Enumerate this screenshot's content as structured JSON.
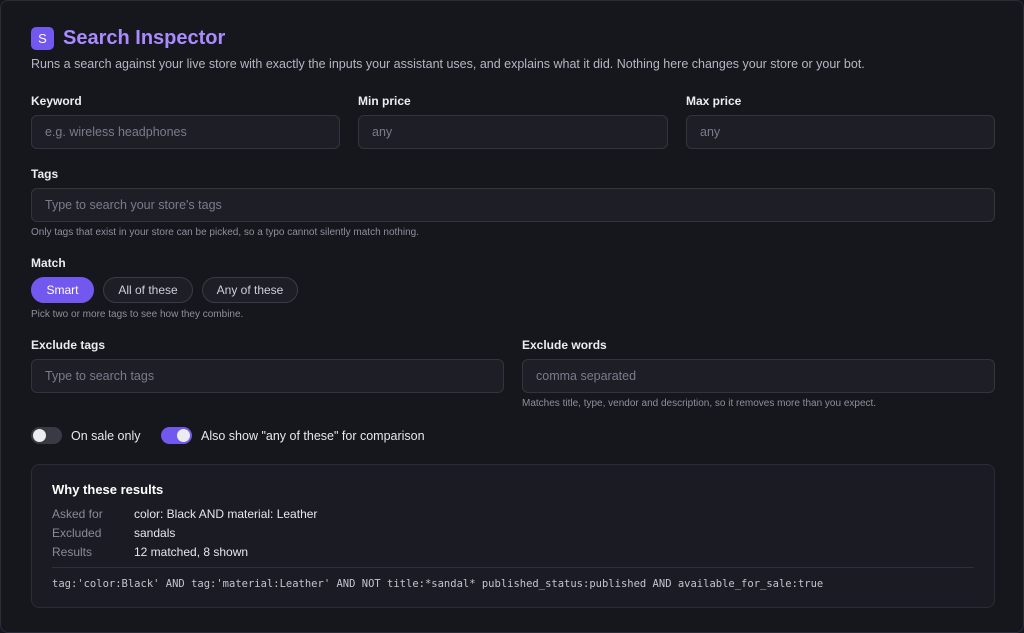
{
  "header": {
    "logo_letter": "S",
    "title": "Search Inspector",
    "subtitle": "Runs a search against your live store with exactly the inputs your assistant uses, and explains what it did. Nothing here changes your store or your bot."
  },
  "keyword": {
    "label": "Keyword",
    "placeholder": "e.g. wireless headphones",
    "value": ""
  },
  "min_price": {
    "label": "Min price",
    "placeholder": "any",
    "value": ""
  },
  "max_price": {
    "label": "Max price",
    "placeholder": "any",
    "value": ""
  },
  "tags": {
    "label": "Tags",
    "placeholder": "Type to search your store's tags",
    "help": "Only tags that exist in your store can be picked, so a typo cannot silently match nothing."
  },
  "match": {
    "label": "Match",
    "options": [
      "Smart",
      "All of these",
      "Any of these"
    ],
    "selected": "Smart",
    "help": "Pick two or more tags to see how they combine."
  },
  "exclude_tags": {
    "label": "Exclude tags",
    "placeholder": "Type to search tags"
  },
  "exclude_words": {
    "label": "Exclude words",
    "placeholder": "comma separated",
    "help": "Matches title, type, vendor and description, so it removes more than you expect."
  },
  "toggles": {
    "on_sale": {
      "label": "On sale only",
      "checked": false
    },
    "compare_any": {
      "label": "Also show \"any of these\" for comparison",
      "checked": true
    }
  },
  "results": {
    "title": "Why these results",
    "rows": [
      {
        "key": "Asked for",
        "value": "color: Black AND material: Leather"
      },
      {
        "key": "Excluded",
        "value": "sandals"
      },
      {
        "key": "Results",
        "value": "12 matched, 8 shown"
      }
    ],
    "query": "tag:'color:Black' AND tag:'material:Leather' AND NOT title:*sandal* published_status:published AND available_for_sale:true"
  },
  "colors": {
    "accent": "#7358f0",
    "title": "#a98bff",
    "background": "#16161d"
  }
}
